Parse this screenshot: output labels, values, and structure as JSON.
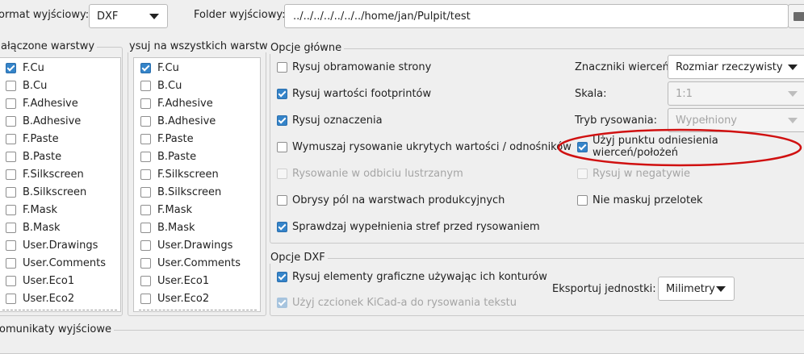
{
  "top": {
    "format_label": "ormat wyjściowy:",
    "format_value": "DXF",
    "folder_label": "Folder wyjściowy:",
    "folder_value": "../../../../../../../home/jan/Pulpit/test"
  },
  "layers_left": {
    "title": "ałączone warstwy",
    "items": [
      {
        "label": "F.Cu",
        "checked": true
      },
      {
        "label": "B.Cu",
        "checked": false
      },
      {
        "label": "F.Adhesive",
        "checked": false
      },
      {
        "label": "B.Adhesive",
        "checked": false
      },
      {
        "label": "F.Paste",
        "checked": false
      },
      {
        "label": "B.Paste",
        "checked": false
      },
      {
        "label": "F.Silkscreen",
        "checked": false
      },
      {
        "label": "B.Silkscreen",
        "checked": false
      },
      {
        "label": "F.Mask",
        "checked": false
      },
      {
        "label": "B.Mask",
        "checked": false
      },
      {
        "label": "User.Drawings",
        "checked": false
      },
      {
        "label": "User.Comments",
        "checked": false
      },
      {
        "label": "User.Eco1",
        "checked": false
      },
      {
        "label": "User.Eco2",
        "checked": false
      }
    ]
  },
  "layers_right": {
    "title": "ysuj na wszystkich warstwac",
    "items": [
      {
        "label": "F.Cu",
        "checked": true
      },
      {
        "label": "B.Cu",
        "checked": false
      },
      {
        "label": "F.Adhesive",
        "checked": false
      },
      {
        "label": "B.Adhesive",
        "checked": false
      },
      {
        "label": "F.Paste",
        "checked": false
      },
      {
        "label": "B.Paste",
        "checked": false
      },
      {
        "label": "F.Silkscreen",
        "checked": false
      },
      {
        "label": "B.Silkscreen",
        "checked": false
      },
      {
        "label": "F.Mask",
        "checked": false
      },
      {
        "label": "B.Mask",
        "checked": false
      },
      {
        "label": "User.Drawings",
        "checked": false
      },
      {
        "label": "User.Comments",
        "checked": false
      },
      {
        "label": "User.Eco1",
        "checked": false
      },
      {
        "label": "User.Eco2",
        "checked": false
      }
    ]
  },
  "main_options": {
    "title": "Opcje główne",
    "left": [
      {
        "label": "Rysuj obramowanie strony",
        "checked": false,
        "disabled": false
      },
      {
        "label": "Rysuj wartości footprintów",
        "checked": true,
        "disabled": false
      },
      {
        "label": "Rysuj oznaczenia",
        "checked": true,
        "disabled": false
      },
      {
        "label": "Wymuszaj rysowanie ukrytych wartości / odnośników",
        "checked": false,
        "disabled": false
      },
      {
        "label": "Rysowanie w odbiciu lustrzanym",
        "checked": false,
        "disabled": true
      },
      {
        "label": "Obrysy pól na warstwach produkcyjnych",
        "checked": false,
        "disabled": false
      },
      {
        "label": "Sprawdzaj wypełnienia stref przed rysowaniem",
        "checked": true,
        "disabled": false
      }
    ],
    "drill_marks_label": "Znaczniki wierceń:",
    "drill_marks_value": "Rozmiar rzeczywisty",
    "scale_label": "Skala:",
    "scale_value": "1:1",
    "mode_label": "Tryb rysowania:",
    "mode_value": "Wypełniony",
    "use_drill_origin": {
      "label": "Użyj punktu odniesienia wierceń/położeń",
      "checked": true
    },
    "negative": {
      "label": "Rysuj w negatywie",
      "checked": false,
      "disabled": true
    },
    "no_tent_vias": {
      "label": "Nie maskuj przelotek",
      "checked": false
    }
  },
  "dxf_options": {
    "title": "Opcje DXF",
    "contours": {
      "label": "Rysuj elementy graficzne używając ich konturów",
      "checked": true
    },
    "kicad_font": {
      "label": "Użyj czcionek KiCad-a do rysowania tekstu",
      "checked": true,
      "disabled": true
    },
    "units_label": "Eksportuj jednostki:",
    "units_value": "Milimetry"
  },
  "messages": {
    "title": "omunikaty wyjściowe"
  },
  "colors": {
    "checkbox_accent": "#3584c9",
    "highlight_ellipse": "#d01010"
  }
}
